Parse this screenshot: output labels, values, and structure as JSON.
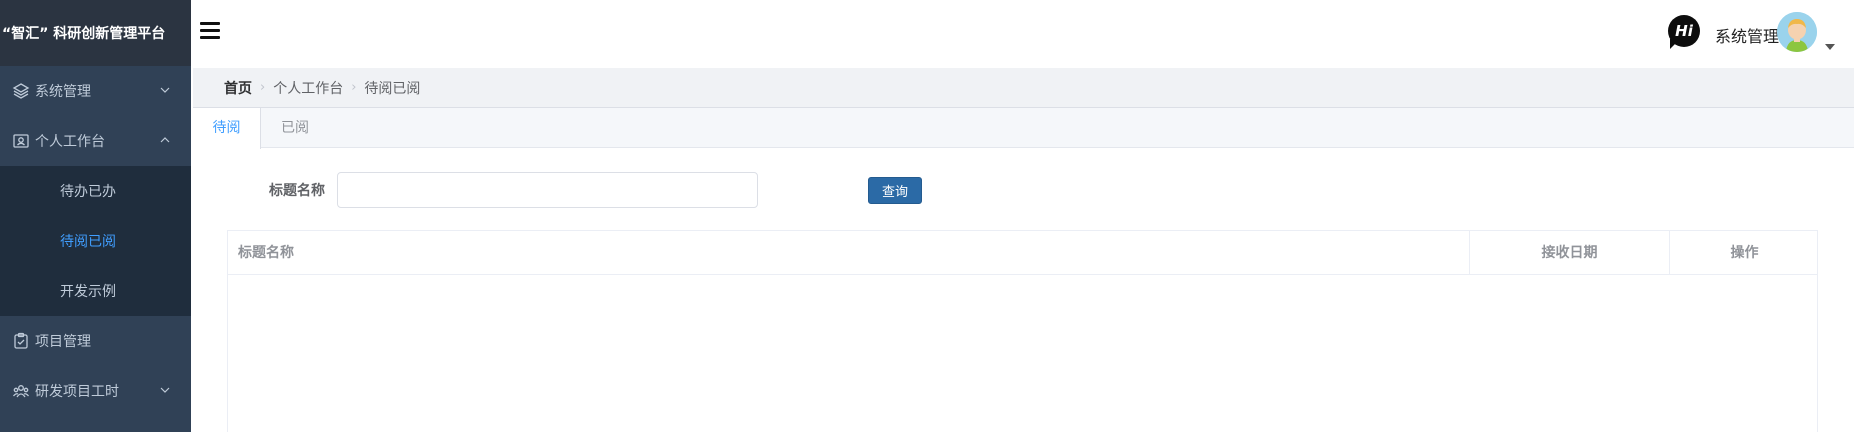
{
  "app": {
    "title": "“智汇”  科研创新管理平台"
  },
  "sidebar": {
    "items": [
      {
        "label": "系统管理",
        "icon": "layers-icon",
        "expandable": true,
        "expanded": false
      },
      {
        "label": "个人工作台",
        "icon": "workbench-icon",
        "expandable": true,
        "expanded": true,
        "children": [
          {
            "label": "待办已办",
            "active": false
          },
          {
            "label": "待阅已阅",
            "active": true
          },
          {
            "label": "开发示例",
            "active": false
          }
        ]
      },
      {
        "label": "项目管理",
        "icon": "clipboard-icon",
        "expandable": false
      },
      {
        "label": "研发项目工时",
        "icon": "team-icon",
        "expandable": true,
        "expanded": false
      }
    ]
  },
  "header": {
    "hi_text": "Hi",
    "user_name": "系统管理"
  },
  "breadcrumb": [
    "首页",
    "个人工作台",
    "待阅已阅"
  ],
  "tabs": [
    {
      "label": "待阅",
      "active": true
    },
    {
      "label": "已阅",
      "active": false
    }
  ],
  "search": {
    "label": "标题名称",
    "value": "",
    "button": "查询"
  },
  "table": {
    "columns": [
      "标题名称",
      "接收日期",
      "操作"
    ],
    "rows": []
  },
  "colors": {
    "sidebar_bg": "#304156",
    "submenu_bg": "#1f2d3d",
    "accent": "#409eff",
    "button": "#2b6aa6"
  }
}
